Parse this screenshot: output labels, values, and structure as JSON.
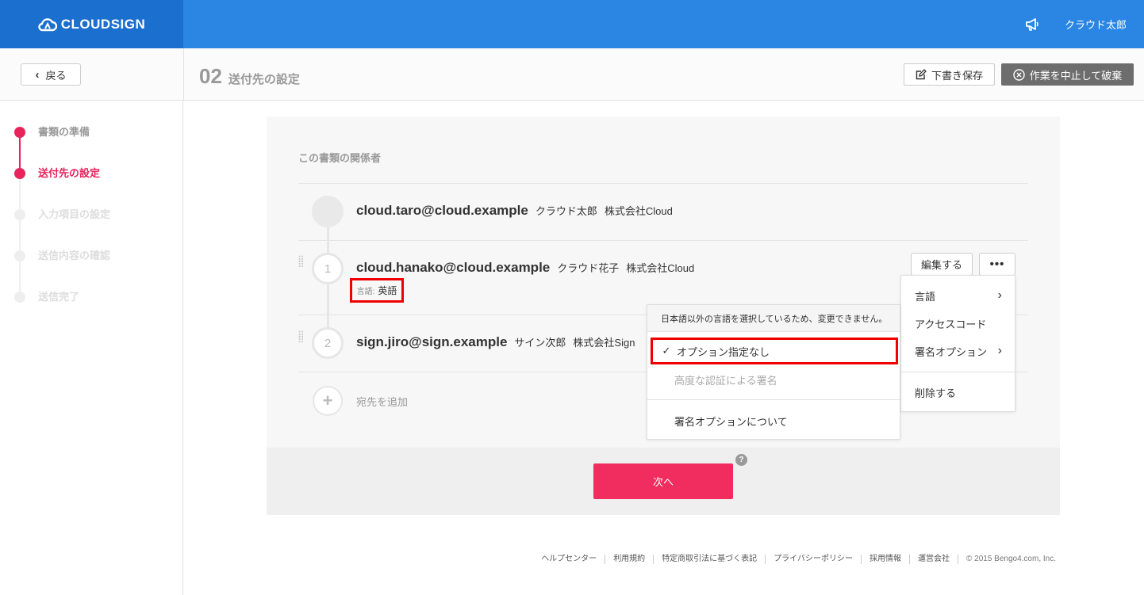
{
  "header": {
    "brand": "CLOUDSIGN",
    "user_name": "クラウド太郎"
  },
  "subheader": {
    "back_label": "戻る",
    "step_number": "02",
    "step_title": "送付先の設定",
    "draft_label": "下書き保存",
    "abort_label": "作業を中止して破棄"
  },
  "sidebar": {
    "steps": [
      {
        "label": "書類の準備",
        "state": "done"
      },
      {
        "label": "送付先の設定",
        "state": "active"
      },
      {
        "label": "入力項目の設定",
        "state": "pending"
      },
      {
        "label": "送信内容の確認",
        "state": "pending"
      },
      {
        "label": "送信完了",
        "state": "pending"
      }
    ]
  },
  "main": {
    "heading": "この書類の関係者",
    "sender": {
      "email": "cloud.taro@cloud.example",
      "name": "クラウド太郎",
      "company": "株式会社Cloud"
    },
    "recipients": [
      {
        "order": "1",
        "email": "cloud.hanako@cloud.example",
        "name": "クラウド花子",
        "company": "株式会社Cloud",
        "lang_key": "言語:",
        "lang_value": "英語"
      },
      {
        "order": "2",
        "email": "sign.jiro@sign.example",
        "name": "サイン次郎",
        "company": "株式会社Sign"
      }
    ],
    "add_label": "宛先を追加",
    "add_icon": "+",
    "edit_label": "編集する",
    "more_label": "•••",
    "next_label": "次へ",
    "help_label": "?"
  },
  "menu": {
    "items": [
      {
        "label": "言語",
        "has_sub": true
      },
      {
        "label": "アクセスコード",
        "has_sub": false
      },
      {
        "label": "署名オプション",
        "has_sub": true
      },
      {
        "label": "削除する",
        "has_sub": false
      }
    ],
    "chevron": "›"
  },
  "submenu": {
    "note": "日本語以外の言語を選択しているため、変更できません。",
    "options": [
      {
        "label": "オプション指定なし",
        "selected": true
      },
      {
        "label": "高度な認証による署名",
        "disabled": true
      },
      {
        "label": "署名オプションについて"
      }
    ],
    "check": "✓"
  },
  "footer": {
    "links": [
      "ヘルプセンター",
      "利用規約",
      "特定商取引法に基づく表記",
      "プライバシーポリシー",
      "採用情報",
      "運営会社"
    ],
    "copyright": "© 2015 Bengo4.com, Inc."
  },
  "colors": {
    "header_blue": "#2b86e3",
    "brand_blue": "#1a6fcf",
    "accent_pink": "#e9235c",
    "next_button": "#f02d5e",
    "highlight_red": "#ee0000"
  }
}
